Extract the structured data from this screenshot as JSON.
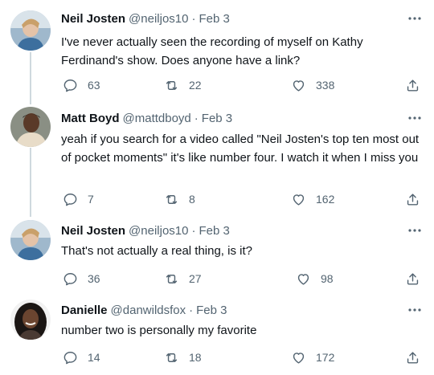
{
  "tweets": [
    {
      "name": "Neil Josten",
      "handle": "@neiljos10",
      "date": "Feb 3",
      "text": "I've never actually seen the recording of myself on Kathy Ferdinand's show. Does anyone have a link?",
      "replies": "63",
      "retweets": "22",
      "likes": "338"
    },
    {
      "name": "Matt Boyd",
      "handle": "@mattdboyd",
      "date": "Feb 3",
      "text": "yeah if you search for a video called \"Neil Josten's top ten most out of pocket moments\" it's like number four. I watch it when I miss you",
      "replies": "7",
      "retweets": "8",
      "likes": "162"
    },
    {
      "name": "Neil Josten",
      "handle": "@neiljos10",
      "date": "Feb 3",
      "text": "That's not actually a real thing, is it?",
      "replies": "36",
      "retweets": "27",
      "likes": "98"
    },
    {
      "name": "Danielle",
      "handle": "@danwildsfox",
      "date": "Feb 3",
      "text": "number two is personally my favorite",
      "replies": "14",
      "retweets": "18",
      "likes": "172"
    }
  ],
  "separator": "·",
  "icons": {
    "more": "more-icon",
    "reply": "reply-icon",
    "retweet": "retweet-icon",
    "like": "like-icon",
    "share": "share-icon"
  },
  "colors": {
    "text": "#0f1419",
    "secondary": "#536471",
    "thread_line": "#cfd9de"
  }
}
